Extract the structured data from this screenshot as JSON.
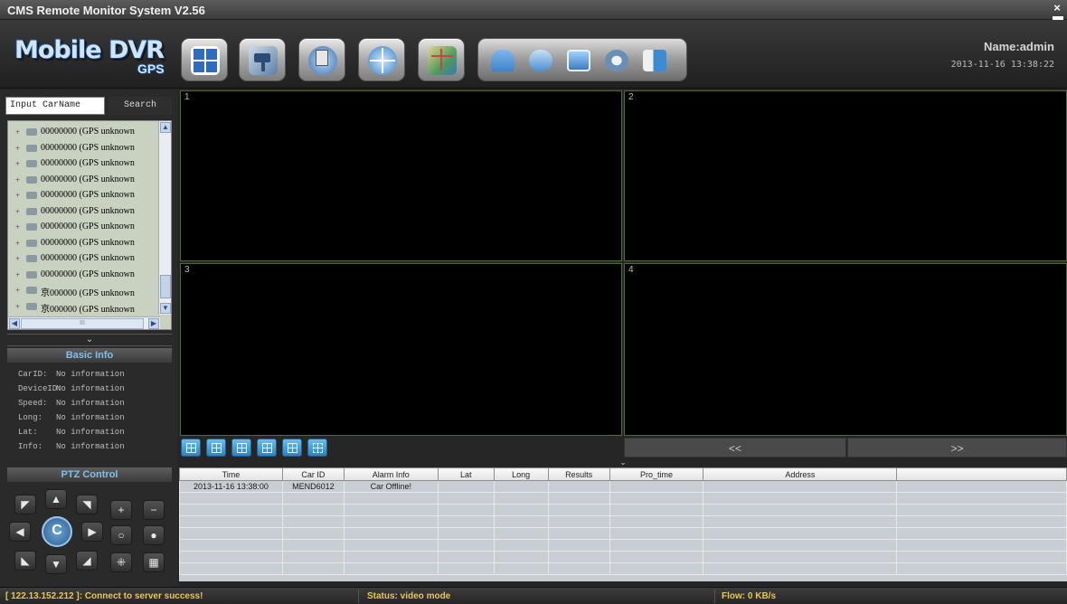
{
  "window": {
    "title": "CMS Remote Monitor System V2.56",
    "close_glyph": "×"
  },
  "header": {
    "logo_main": "Mobile DVR",
    "logo_sub": "GPS",
    "toolbar_buttons": [
      {
        "icon": "split-screen-icon",
        "color": "#2f6cc0"
      },
      {
        "icon": "camera-icon",
        "color": "#5a7fa6"
      },
      {
        "icon": "playback-icon",
        "color": "#3f74b4"
      },
      {
        "icon": "gps-globe-icon",
        "color": "#3a82c8"
      },
      {
        "icon": "map-icon",
        "color": "#4d9a5d"
      }
    ],
    "group_icons": [
      {
        "icon": "users-icon",
        "color": "#3f84cb"
      },
      {
        "icon": "device-icon",
        "color": "#4a8ed1"
      },
      {
        "icon": "monitor-icon",
        "color": "#3d7cc4"
      },
      {
        "icon": "settings-icon",
        "color": "#6a8fb5"
      },
      {
        "icon": "book-icon",
        "color": "#3c8bd3"
      }
    ],
    "user": "Name:admin",
    "datetime": "2013-11-16 13:38:22"
  },
  "search": {
    "value": "Input CarName",
    "button_label": "Search"
  },
  "tree": {
    "items": [
      "00000000 (GPS  unknown",
      "00000000 (GPS  unknown",
      "00000000 (GPS  unknown",
      "00000000 (GPS  unknown",
      "00000000 (GPS  unknown",
      "00000000 (GPS  unknown",
      "00000000 (GPS  unknown",
      "00000000 (GPS  unknown",
      "00000000 (GPS  unknown",
      "00000000 (GPS  unknown",
      "京000000 (GPS  unknown",
      "京000000 (GPS  unknown"
    ],
    "hscroll_thumb": "III"
  },
  "basic_info": {
    "title": "Basic Info",
    "rows": [
      {
        "key": "CarID:",
        "value": "No information"
      },
      {
        "key": "DeviceID:",
        "value": "No information"
      },
      {
        "key": "Speed:",
        "value": "No information"
      },
      {
        "key": "Long:",
        "value": "No information"
      },
      {
        "key": "Lat:",
        "value": "No information"
      },
      {
        "key": "Info:",
        "value": "No information"
      }
    ]
  },
  "ptz": {
    "title": "PTZ Control",
    "plus": "+",
    "minus": "−",
    "center": "C"
  },
  "panes": [
    "1",
    "2",
    "3",
    "4"
  ],
  "pager": {
    "prev": "<<",
    "next": ">>"
  },
  "alarm_table": {
    "columns": [
      "Time",
      "Car ID",
      "Alarm Info",
      "Lat",
      "Long",
      "Results",
      "Pro_time",
      "Address",
      ""
    ],
    "rows": [
      [
        "2013-11-16 13:38:00",
        "MEND6012",
        "Car Offline!",
        "",
        "",
        "",
        "",
        "",
        ""
      ]
    ],
    "empty_rows": 7
  },
  "status": {
    "connection": "[ 122.13.152.212 ]: Connect to server success!",
    "mode": "Status: video mode",
    "flow": "Flow: 0 KB/s"
  }
}
